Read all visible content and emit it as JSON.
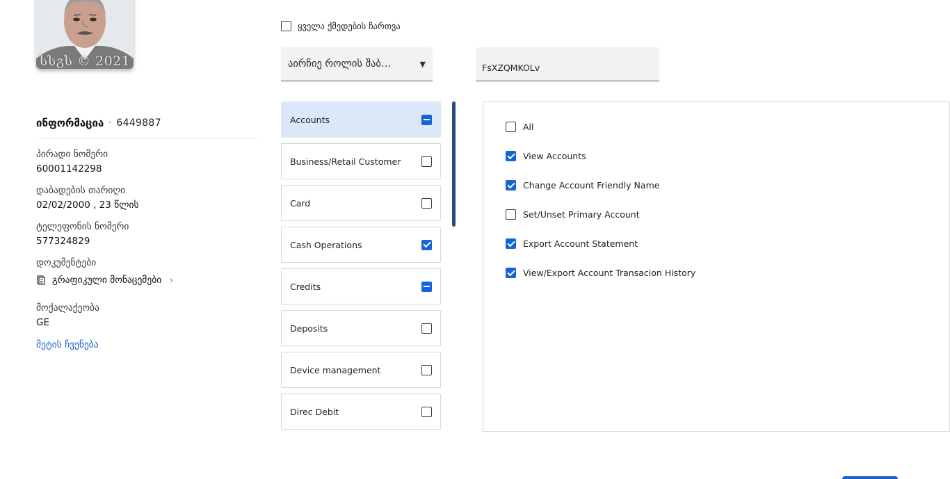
{
  "photo": {
    "watermark": "სსგს © 2021"
  },
  "info": {
    "title": "ინფორმაცია",
    "separator": "·",
    "customer_id": "6449887"
  },
  "fields": [
    {
      "label": "პირადი ნომერი",
      "value": "60001142298"
    },
    {
      "label": "დაბადების თარიღი",
      "value": "02/02/2000 , 23 წლის"
    },
    {
      "label": "ტელეფონის ნომერი",
      "value": "577324829"
    }
  ],
  "documents": {
    "label": "დოკუმენტები",
    "link_text": "გრაფიკული მონაცემები",
    "icon": "document-icon"
  },
  "citizenship": {
    "label": "მოქალაქეობა",
    "value": "GE"
  },
  "show_more": "მეტის ჩვენება",
  "enable_all": {
    "label": "ყველა ქმედების ჩართვა",
    "checked": false
  },
  "role_select": {
    "text": "აირჩიე როლის შაბ…",
    "icon": "chevron-down-icon"
  },
  "name_input": {
    "value": "FsXZQMKOLv"
  },
  "categories": [
    {
      "label": "Accounts",
      "state": "partial",
      "selected": true
    },
    {
      "label": "Business/Retail Customer",
      "state": "unchecked",
      "selected": false
    },
    {
      "label": "Card",
      "state": "unchecked",
      "selected": false
    },
    {
      "label": "Cash Operations",
      "state": "checked",
      "selected": false
    },
    {
      "label": "Credits",
      "state": "partial",
      "selected": false
    },
    {
      "label": "Deposits",
      "state": "unchecked",
      "selected": false
    },
    {
      "label": "Device management",
      "state": "unchecked",
      "selected": false
    },
    {
      "label": "Direc Debit",
      "state": "unchecked",
      "selected": false
    }
  ],
  "permissions": [
    {
      "label": "All",
      "checked": false
    },
    {
      "label": "View Accounts",
      "checked": true
    },
    {
      "label": "Change Account Friendly Name",
      "checked": true
    },
    {
      "label": "Set/Unset Primary Account",
      "checked": false
    },
    {
      "label": "Export Account Statement",
      "checked": true
    },
    {
      "label": "View/Export Account Transacion History",
      "checked": true
    }
  ],
  "colors": {
    "accent": "#1565d8",
    "link": "#1a62c8",
    "selected_bg": "#dce8f8",
    "scrollbar": "#2f4a7a"
  }
}
